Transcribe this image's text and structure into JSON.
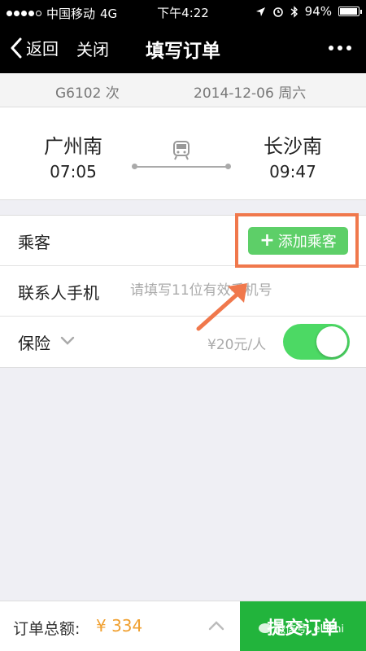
{
  "status_bar": {
    "carrier": "中国移动",
    "network": "4G",
    "time": "下午4:22",
    "battery": "94%",
    "battery_level": 0.94
  },
  "nav": {
    "back_label": "返回",
    "close_label": "关闭",
    "title": "填写订单"
  },
  "train": {
    "number": "G6102 次",
    "date": "2014-12-06 周六"
  },
  "route": {
    "from_station": "广州南",
    "from_time": "07:05",
    "to_station": "长沙南",
    "to_time": "09:47"
  },
  "form": {
    "passenger_label": "乘客",
    "add_passenger_label": "添加乘客",
    "phone_label": "联系人手机",
    "phone_placeholder": "请填写11位有效手机号",
    "insurance_label": "保险",
    "insurance_price": "¥20元/人",
    "insurance_enabled": true
  },
  "footer": {
    "total_label": "订单总额:",
    "total_value": "¥ 334",
    "submit_label": "提交订单"
  },
  "watermark": {
    "text": "微信号: eLizhi"
  },
  "colors": {
    "accent_green": "#5dcf68",
    "highlight_orange": "#f0784c",
    "price_orange": "#f0a030",
    "toggle_green": "#4cd964"
  }
}
